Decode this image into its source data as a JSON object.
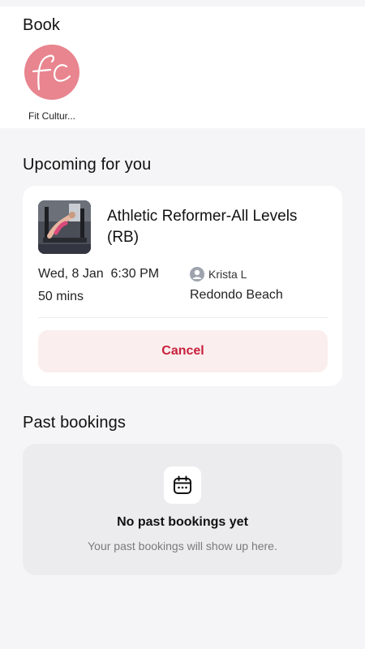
{
  "book": {
    "title": "Book",
    "studio": {
      "logo_text": "fc",
      "name": "Fit Cultur...",
      "logo_color": "#e8858f"
    }
  },
  "upcoming": {
    "title": "Upcoming for you",
    "booking": {
      "class_name": "Athletic Reformer-All Levels (RB)",
      "date": "Wed, 8 Jan",
      "time": "6:30 PM",
      "duration": "50 mins",
      "instructor": "Krista L",
      "location": "Redondo Beach",
      "cancel_label": "Cancel",
      "cancel_color": "#c8203c"
    }
  },
  "past": {
    "title": "Past bookings",
    "empty_title": "No past bookings yet",
    "empty_subtitle": "Your past bookings will show up here."
  },
  "icons": {
    "studio_logo": "studio-logo",
    "instructor": "person-avatar-icon",
    "empty_state": "calendar-icon"
  }
}
